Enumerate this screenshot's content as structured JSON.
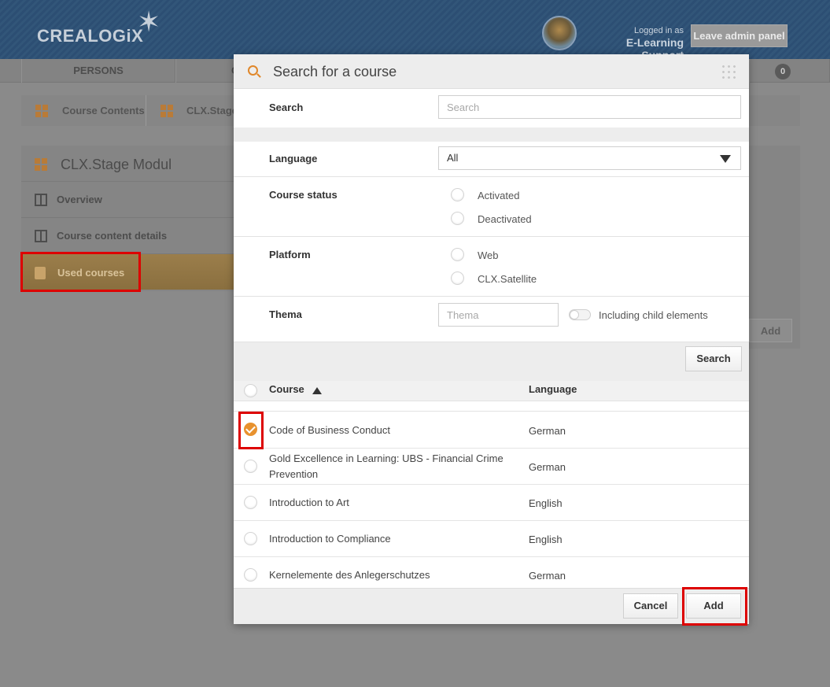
{
  "header": {
    "logo_text": "CREALOGiX",
    "logo_star": "✶",
    "logged_in_label": "Logged in as",
    "user_name": "E-Learning Support",
    "leave_button": "Leave admin panel"
  },
  "nav": {
    "items": [
      "PERSONS",
      "C"
    ],
    "badge_count": "0"
  },
  "breadcrumb": {
    "items": [
      "Course Contents",
      "CLX.Stage"
    ]
  },
  "sidebar": {
    "title": "CLX.Stage Modul",
    "items": [
      {
        "label": "Overview",
        "icon": "overview-grid-icon"
      },
      {
        "label": "Course content details",
        "icon": "puzzle-icon"
      },
      {
        "label": "Used courses",
        "icon": "book-icon",
        "active": true
      }
    ]
  },
  "background_add_button": "Add",
  "modal": {
    "title": "Search for a course",
    "search": {
      "label": "Search",
      "placeholder": "Search"
    },
    "language": {
      "label": "Language",
      "selected": "All"
    },
    "course_status": {
      "label": "Course status",
      "options": [
        "Activated",
        "Deactivated"
      ]
    },
    "platform": {
      "label": "Platform",
      "options": [
        "Web",
        "CLX.Satellite"
      ]
    },
    "thema": {
      "label": "Thema",
      "placeholder": "Thema",
      "toggle_label": "Including child elements"
    },
    "search_button": "Search",
    "table": {
      "headers": {
        "course": "Course",
        "language": "Language"
      },
      "sort": "ascending",
      "rows": [
        {
          "course": "Code of Business Conduct",
          "language": "German",
          "checked": true
        },
        {
          "course": "Gold Excellence in Learning: UBS - Financial Crime Prevention",
          "language": "German",
          "checked": false
        },
        {
          "course": "Introduction to Art",
          "language": "English",
          "checked": false
        },
        {
          "course": "Introduction to Compliance",
          "language": "English",
          "checked": false
        },
        {
          "course": "Kernelemente des Anlegerschutzes",
          "language": "German",
          "checked": false
        }
      ]
    },
    "cancel_button": "Cancel",
    "add_button": "Add"
  },
  "colors": {
    "accent": "#e8922e",
    "header_bg": "#2c4e73",
    "highlight": "#dd0000"
  }
}
